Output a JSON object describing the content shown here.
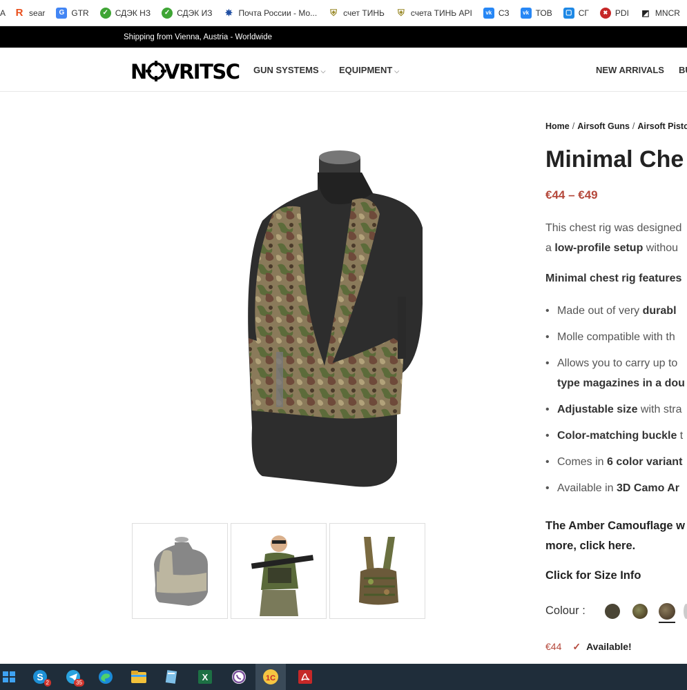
{
  "bookmarks": [
    {
      "label": "A",
      "icon": "generic-icon"
    },
    {
      "label": "sear",
      "icon": "r-logo-icon"
    },
    {
      "label": "GTR",
      "icon": "translate-icon"
    },
    {
      "label": "СДЭК НЗ",
      "icon": "cdek-icon"
    },
    {
      "label": "СДЭК ИЗ",
      "icon": "cdek-icon"
    },
    {
      "label": "Почта России - Мо...",
      "icon": "russian-post-icon"
    },
    {
      "label": "счет ТИНЬ",
      "icon": "tinkoff-icon"
    },
    {
      "label": "счета ТИНЬ API",
      "icon": "tinkoff-icon"
    },
    {
      "label": "СЗ",
      "icon": "vk-icon"
    },
    {
      "label": "ТОВ",
      "icon": "vk-icon"
    },
    {
      "label": "СГ",
      "icon": "blue-square-icon"
    },
    {
      "label": "PDI",
      "icon": "pdi-icon"
    },
    {
      "label": "MNCR",
      "icon": "mncr-icon"
    }
  ],
  "shipping_text": "Shipping from Vienna, Austria - Worldwide",
  "header": {
    "logo": "NOVRITSCH",
    "nav": [
      "GUN SYSTEMS",
      "EQUIPMENT",
      "NEW ARRIVALS",
      "BU"
    ]
  },
  "product": {
    "breadcrumbs": [
      "Home",
      "Airsoft Guns",
      "Airsoft Pisto"
    ],
    "title": "Minimal Che",
    "price": "€44 – €49",
    "desc_line1": "This chest rig was designed",
    "desc_line2_prefix": "a ",
    "desc_line2_bold": "low-profile setup",
    "desc_line2_suffix": " withou",
    "features_heading": "Minimal chest rig features",
    "bullets": [
      {
        "pre": "Made out of very ",
        "bold": "durabl",
        "post": ""
      },
      {
        "pre": "Molle compatible with th",
        "bold": "",
        "post": ""
      },
      {
        "pre": "Allows you to carry up to",
        "bold": "",
        "post": ""
      },
      {
        "pre": "",
        "bold": "type magazines in a dou",
        "post": ""
      },
      {
        "pre": "",
        "bold": "Adjustable size",
        "post": " with stra"
      },
      {
        "pre": "",
        "bold": "Color-matching buckle",
        "post": " t"
      },
      {
        "pre": "Comes in ",
        "bold": "6 color variant",
        "post": ""
      },
      {
        "pre": "Available in ",
        "bold": "3D Camo Ar",
        "post": ""
      }
    ],
    "amber_line1": "The Amber Camouflage w",
    "amber_line2": "more, click here.",
    "size_info": "Click for Size Info",
    "colour_label": "Colour :",
    "swatch_colors": [
      "#4a4535",
      "#6b6040",
      "#6d5c45"
    ],
    "variant_price": "€44",
    "availability": "Available!"
  },
  "taskbar": {
    "skype_badge": "2",
    "telegram_badge": "35"
  }
}
